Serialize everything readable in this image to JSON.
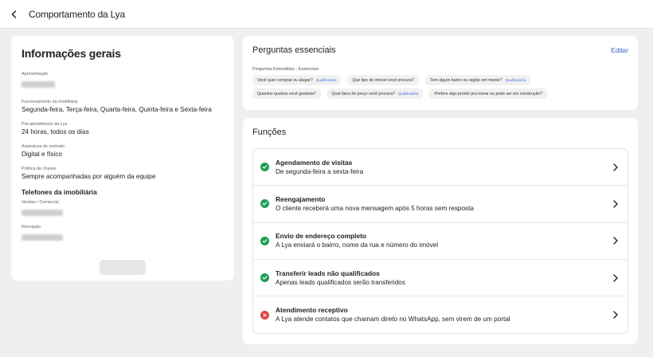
{
  "topbar": {
    "title": "Comportamento da Lya"
  },
  "general": {
    "title": "Informações gerais",
    "fields": [
      {
        "label": "Apresentação",
        "value": ""
      },
      {
        "label": "Funcionamento da imobiliária",
        "value": "Segunda-feira, Terça-feira, Quarta-feira, Quinta-feira e Sexta-feira"
      },
      {
        "label": "Pré-atendimento da Lya",
        "value": "24 horas, todos os dias"
      },
      {
        "label": "Assinatura de contrato",
        "value": "Digital e físico"
      },
      {
        "label": "Política de chaves",
        "value": "Sempre acompanhadas por alguém da equipe"
      }
    ],
    "phones_title": "Telefones da imobiliária",
    "phones": [
      {
        "label": "Vendas / Comercial",
        "value": ""
      },
      {
        "label": "Recepção",
        "value": ""
      }
    ]
  },
  "essential": {
    "title": "Perguntas essenciais",
    "edit_label": "Editar",
    "subtitle": "Perguntas Estendidas - Essenciais",
    "row1": [
      {
        "text": "Você quer comprar ou alugar?",
        "tag": "Qualificatória"
      },
      {
        "text": "Que tipo de imóvel você procura?",
        "tag": ""
      },
      {
        "text": "Tem algum bairro ou região em mente?",
        "tag": "Qualificatória"
      }
    ],
    "row2": [
      {
        "text": "Quantos quartos você gostaria?",
        "tag": ""
      },
      {
        "text": "Qual faixa de preço você procura?",
        "tag": "Qualificatória"
      },
      {
        "text": "Prefere algo pronto pra morar ou pode ser em construção?",
        "tag": ""
      }
    ]
  },
  "functions": {
    "title": "Funções",
    "items": [
      {
        "title": "Agendamento de visitas",
        "desc": "De segunda-feira a sexta-feira",
        "enabled": true
      },
      {
        "title": "Reengajamento",
        "desc": "O cliente receberá uma nova mensagem após 5 horas sem resposta",
        "enabled": true
      },
      {
        "title": "Envio de endereço completo",
        "desc": "A Lya enviará o bairro, nome da rua e número do imóvel",
        "enabled": true
      },
      {
        "title": "Transferir leads não qualificados",
        "desc": "Apenas leads qualificados serão transferidos",
        "enabled": true
      },
      {
        "title": "Atendimento receptivo",
        "desc": "A Lya atende contatos que chamam direto no WhatsApp, sem virem de um portal",
        "enabled": false
      }
    ]
  },
  "colors": {
    "accent": "#2f5fc9",
    "ok": "#1f9d55",
    "error": "#e04444"
  }
}
